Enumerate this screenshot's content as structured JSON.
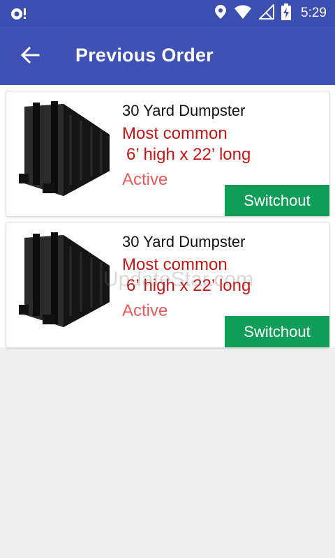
{
  "status_bar": {
    "time": "5:29",
    "icons": [
      "notification-badge-icon",
      "location-icon",
      "wifi-icon",
      "signal-icon",
      "battery-charging-icon"
    ],
    "color": "#3a4fb0"
  },
  "app_bar": {
    "title": "Previous Order",
    "back_icon": "arrow-left-icon",
    "color": "#3f51b5"
  },
  "orders": [
    {
      "title": "30 Yard Dumpster",
      "desc_line1": "Most common",
      "desc_line2": "6’ high x 22’ long",
      "status": "Active",
      "button_label": "Switchout"
    },
    {
      "title": "30 Yard Dumpster",
      "desc_line1": "Most common",
      "desc_line2": "6’ high x 22’ long",
      "status": "Active",
      "button_label": "Switchout"
    }
  ],
  "watermark": "UpdateStar.com",
  "colors": {
    "desc_text": "#c31616",
    "status_text": "#e65a5a",
    "button": "#0f9d58",
    "background": "#efefef"
  }
}
